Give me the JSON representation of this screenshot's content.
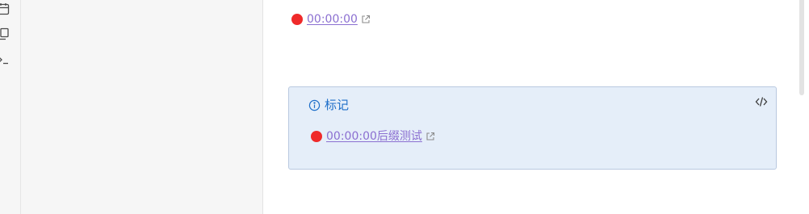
{
  "ribbon": {
    "icons": [
      "calendar-icon",
      "files-icon",
      "terminal-icon"
    ]
  },
  "editor": {
    "timestamp_link": {
      "text": "00:00:00",
      "dot_color": "#ef2a2a"
    },
    "callout": {
      "title": "标记",
      "timestamp_link": {
        "text": "00:00:00后缀测试",
        "dot_color": "#ef2a2a"
      }
    }
  },
  "colors": {
    "link": "#8b6fd1",
    "callout_background": "#e5eef9",
    "callout_border": "#b9c9e0",
    "callout_title": "#1f6fc9",
    "recording_dot": "#ef2a2a"
  }
}
